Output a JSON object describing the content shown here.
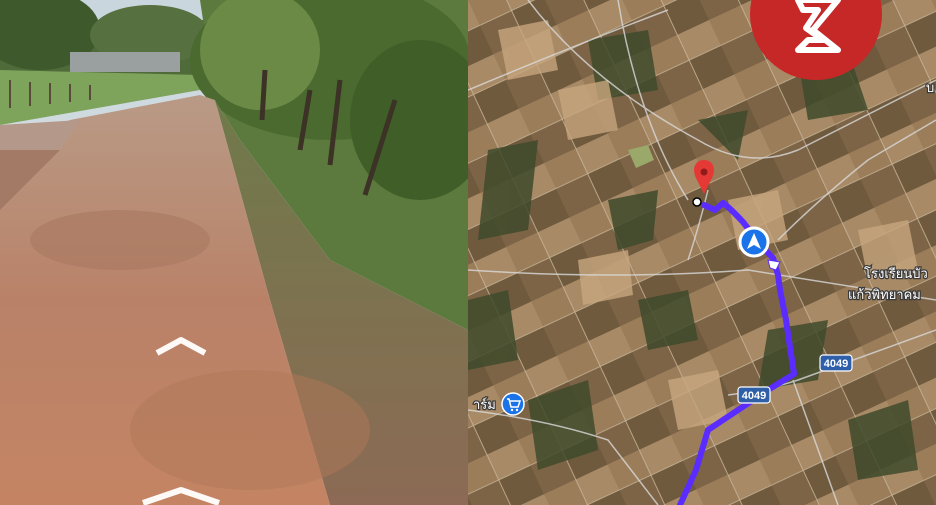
{
  "street_view": {
    "nav_arrows": [
      "forward-arrow",
      "backward-arrow"
    ]
  },
  "map": {
    "type": "satellite",
    "route_color": "#5b2cff",
    "pin_color": "#e53935",
    "labels": {
      "school_line1": "โรงเรียนบัว",
      "school_line2": "แก้วพิทยาคม",
      "road_4049_a": "4049",
      "road_4049_b": "4049",
      "farm_partial": "าร์ม",
      "edge_partial": "บ"
    },
    "icons": [
      "location-pin-icon",
      "my-location-arrow-icon",
      "shop-cart-icon",
      "brand-logo-icon"
    ]
  }
}
